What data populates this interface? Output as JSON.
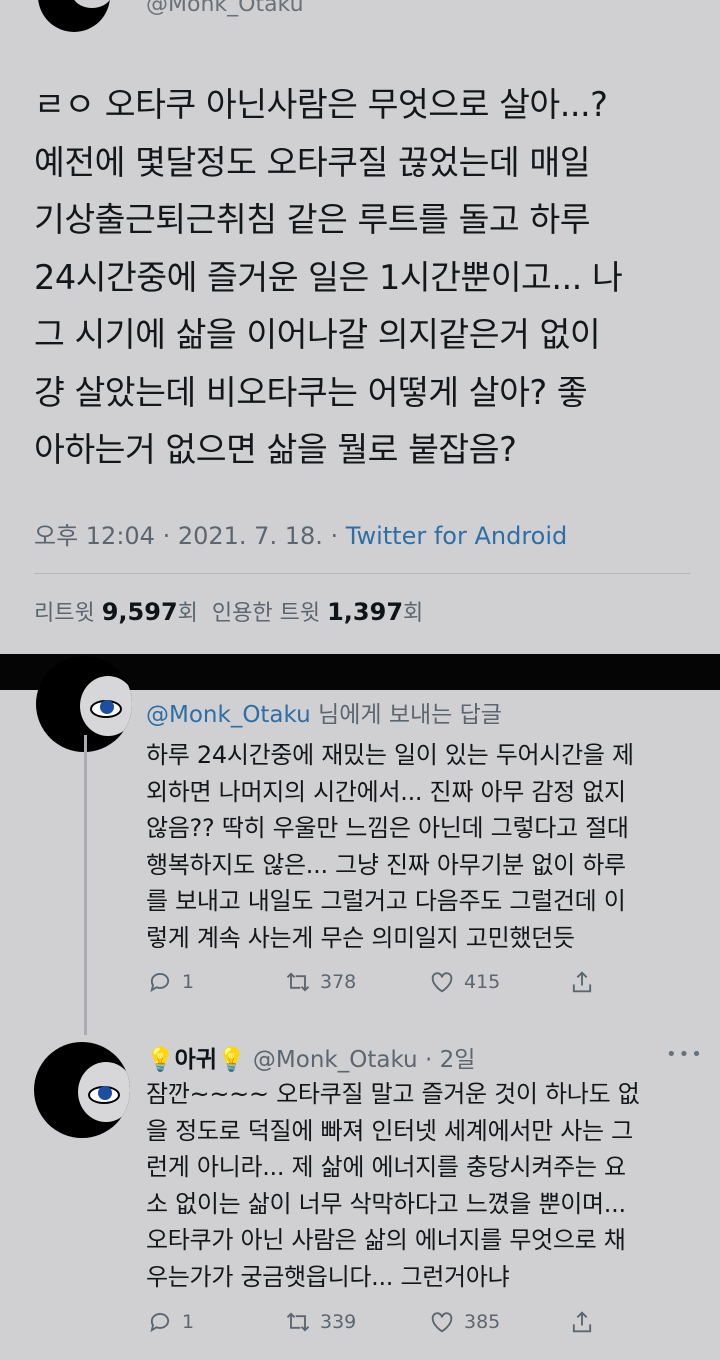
{
  "top_tweet": {
    "handle": "@Monk_Otaku",
    "text": "ㄹㅇ 오타쿠 아닌사람은 무엇으로 살아...?\n예전에 몇달정도 오타쿠질 끊었는데 매일\n기상출근퇴근취침 같은 루트를 돌고 하루\n24시간중에 즐거운 일은 1시간뿐이고... 나\n그 시기에 삶을 이어나갈 의지같은거 없이\n걍 살았는데 비오타쿠는 어떻게 살아? 좋\n아하는거 없으면 삶을 뭘로 붙잡음?",
    "time": "오후 12:04 · 2021. 7. 18. · ",
    "source": "Twitter for Android",
    "retweet_label": "리트윗",
    "retweet_count": "9,597",
    "retweet_unit": "회",
    "quote_label": "인용한 트윗",
    "quote_count": "1,397",
    "quote_unit": "회"
  },
  "reply1": {
    "reply_to_handle": "@Monk_Otaku",
    "reply_to_suffix": " 님에게 보내는 답글",
    "text": "하루 24시간중에 재밌는 일이 있는 두어시간을 제\n외하면 나머지의 시간에서... 진짜 아무 감정 없지\n않음?? 딱히 우울만 느낌은 아닌데 그렇다고 절대\n행복하지도 않은... 그냥 진짜 아무기분 없이 하루\n를 보내고 내일도 그럴거고 다음주도 그럴건데 이\n렇게 계속 사는게 무슨 의미일지 고민했던듯",
    "replies": "1",
    "retweets": "378",
    "likes": "415"
  },
  "reply2": {
    "name": "아귀",
    "handle_time": "@Monk_Otaku · 2일",
    "text": "잠깐~~~~ 오타쿠질 말고 즐거운 것이 하나도 없\n을 정도로 덕질에 빠져 인터넷 세계에서만 사는 그\n런게 아니라... 제 삶에 에너지를 충당시켜주는 요\n소 없이는 삶이 너무 삭막하다고 느꼈을 뿐이며...\n오타쿠가 아닌 사람은 삶의 에너지를 무엇으로 채\n우는가가 궁금햇읍니다... 그런거아냐",
    "replies": "1",
    "retweets": "339",
    "likes": "385"
  },
  "icons": [
    "lightbulb-icon",
    "reply-icon",
    "retweet-icon",
    "like-icon",
    "share-icon",
    "more-icon"
  ],
  "colors": {
    "link": "#2c6fa6",
    "muted": "#5b6670",
    "background": "#d0d0d2"
  }
}
